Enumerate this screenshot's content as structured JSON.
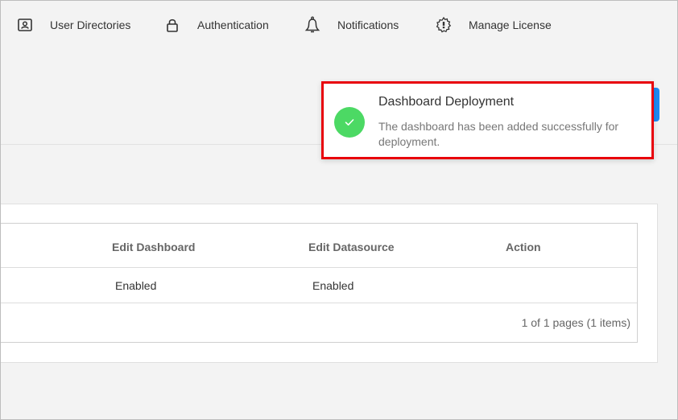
{
  "nav": {
    "items": [
      {
        "label": "User Directories",
        "icon": "user-card-icon"
      },
      {
        "label": "Authentication",
        "icon": "lock-icon"
      },
      {
        "label": "Notifications",
        "icon": "bell-icon"
      },
      {
        "label": "Manage License",
        "icon": "license-gear-icon"
      }
    ]
  },
  "grid": {
    "columns": [
      "Edit Dashboard",
      "Edit Datasource",
      "Action"
    ],
    "rows": [
      {
        "edit_dashboard": "Enabled",
        "edit_datasource": "Enabled",
        "action": ""
      }
    ],
    "pager_text": "1 of 1 pages (1 items)"
  },
  "toast": {
    "title": "Dashboard Deployment",
    "message": "The dashboard has been added successfully for deployment.",
    "icon": "check-icon",
    "accent_color": "#4cd964",
    "highlight_color": "#e8000b"
  },
  "colors": {
    "primary": "#1d89f2"
  }
}
